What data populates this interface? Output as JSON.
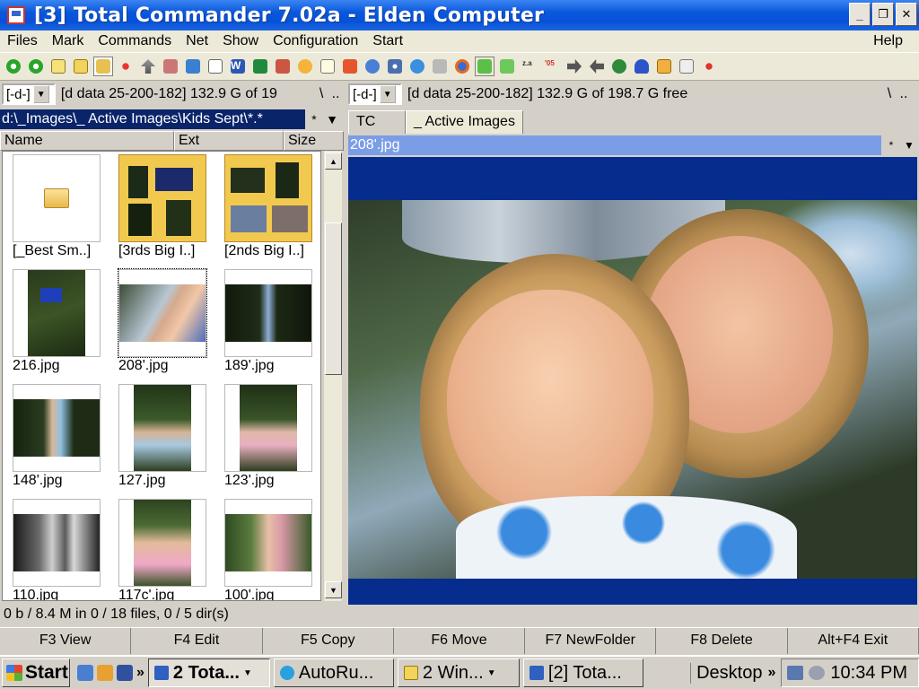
{
  "window": {
    "title": "[3] Total Commander 7.02a - Elden Computer"
  },
  "menu": [
    "Files",
    "Mark",
    "Commands",
    "Net",
    "Show",
    "Configuration",
    "Start"
  ],
  "menu_help": "Help",
  "left_panel": {
    "drive": "[-d-]",
    "drive_info": "[d data 25-200-182]  132.9 G of 19",
    "drive_info_btn1": "\\",
    "drive_info_btn2": "..",
    "path": "d:\\_Images\\_  Active Images\\Kids Sept\\*.*",
    "path_btn1": "*",
    "path_btn2": "▼",
    "columns": {
      "name": "Name",
      "ext": "Ext",
      "size": "Size"
    },
    "items": [
      {
        "label": "[_Best Sm..]"
      },
      {
        "label": "[3rds Big I..]"
      },
      {
        "label": "[2nds Big I..]"
      },
      {
        "label": "216.jpg"
      },
      {
        "label": "208'.jpg"
      },
      {
        "label": "189'.jpg"
      },
      {
        "label": "148'.jpg"
      },
      {
        "label": "127.jpg"
      },
      {
        "label": "123'.jpg"
      },
      {
        "label": "110.jpg"
      },
      {
        "label": "117c'.jpg"
      },
      {
        "label": "100'.jpg"
      }
    ]
  },
  "right_panel": {
    "drive": "[-d-]",
    "drive_info": "[d data 25-200-182]  132.9 G of 198.7 G free",
    "drive_info_btn1": "\\",
    "drive_info_btn2": "..",
    "tabs": [
      "TC",
      "_  Active Images"
    ],
    "viewer_file": "208'.jpg",
    "viewer_btn1": "*",
    "viewer_btn2": "▼"
  },
  "status": "0 b / 8.4 M in 0 / 18 files, 0 / 5 dir(s)",
  "fkeys": [
    "F3 View",
    "F4 Edit",
    "F5 Copy",
    "F6 Move",
    "F7 NewFolder",
    "F8 Delete",
    "Alt+F4 Exit"
  ],
  "taskbar": {
    "start": "Start",
    "tasks": [
      "2 Tota...",
      "AutoRu...",
      "2 Win...",
      "[2] Tota..."
    ],
    "desktop": "Desktop",
    "chevron": "»",
    "clock": "10:34 PM"
  }
}
